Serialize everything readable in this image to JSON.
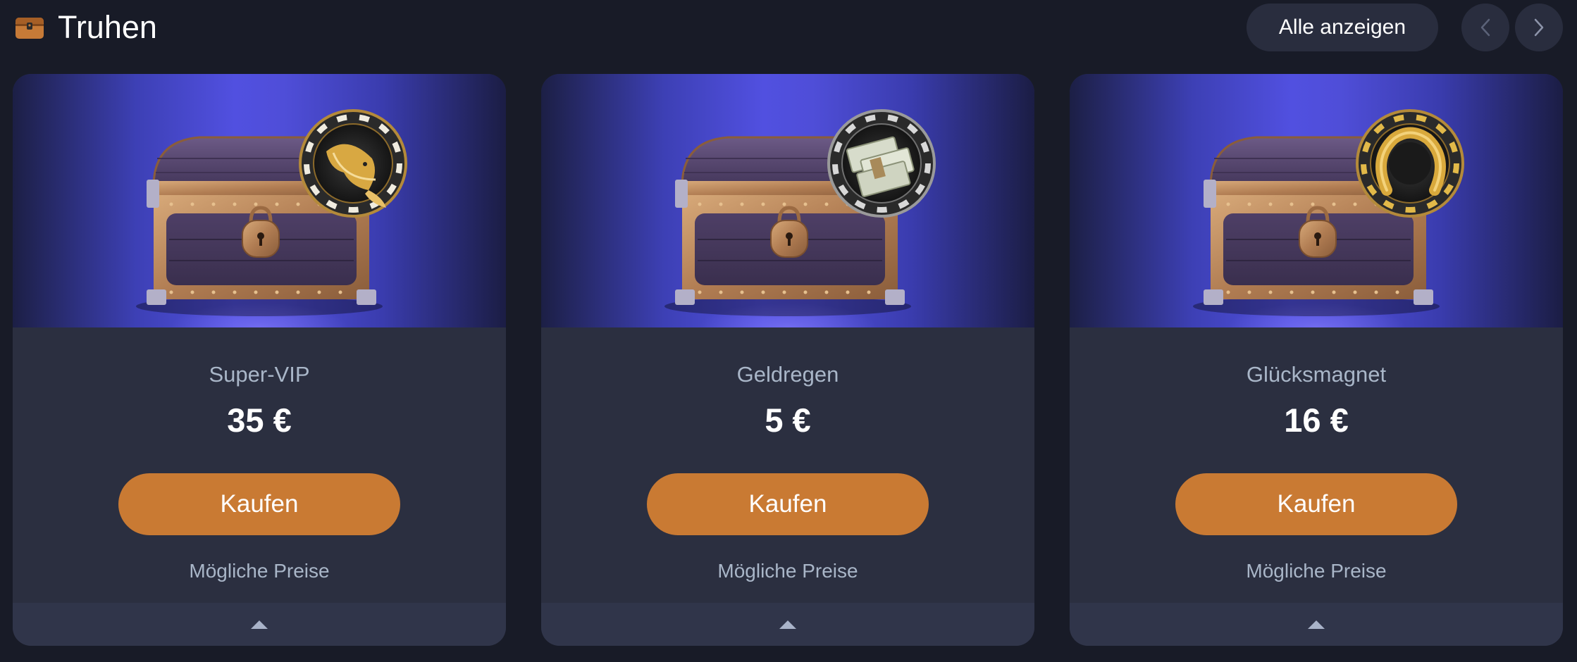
{
  "header": {
    "icon": "treasure-chest-icon",
    "title": "Truhen",
    "show_all_label": "Alle anzeigen",
    "prev_icon": "chevron-left-icon",
    "next_icon": "chevron-right-icon"
  },
  "colors": {
    "background": "#181b27",
    "card": "#2b2f40",
    "accent_button": "#c97a33",
    "muted_text": "#a9b6c8",
    "image_gradient": "#5150e0"
  },
  "cards": [
    {
      "name": "Super-VIP",
      "price": "35 €",
      "buy_label": "Kaufen",
      "prizes_label": "Mögliche Preise",
      "badge_icon": "golden-fish-icon"
    },
    {
      "name": "Geldregen",
      "price": "5 €",
      "buy_label": "Kaufen",
      "prizes_label": "Mögliche Preise",
      "badge_icon": "money-stack-icon"
    },
    {
      "name": "Glücksmagnet",
      "price": "16 €",
      "buy_label": "Kaufen",
      "prizes_label": "Mögliche Preise",
      "badge_icon": "horseshoe-icon"
    }
  ]
}
